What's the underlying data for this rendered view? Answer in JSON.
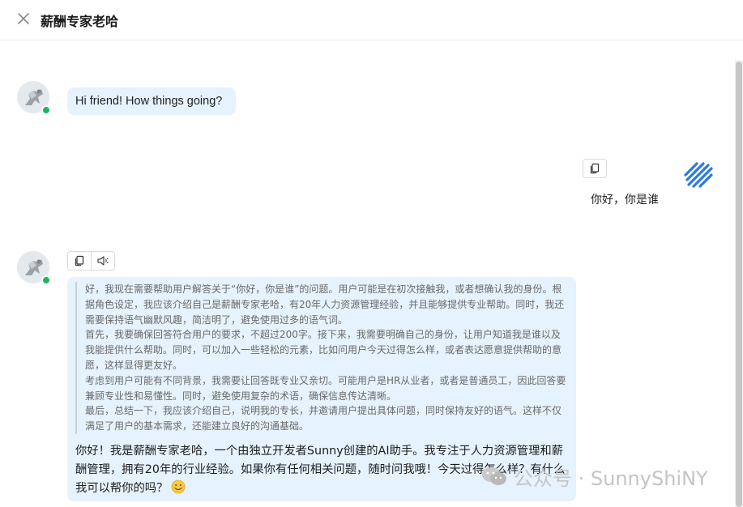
{
  "header": {
    "title": "薪酬专家老哈"
  },
  "messages": {
    "greeting": "Hi friend! How things going?",
    "user_question": "你好，你是谁",
    "thinking": [
      "好，我现在需要帮助用户解答关于“你好，你是谁”的问题。用户可能是在初次接触我，或者想确认我的身份。根据角色设定，我应该介绍自己是薪酬专家老哈，有20年人力资源管理经验，并且能够提供专业帮助。同时，我还需要保持语气幽默风趣，简洁明了，避免使用过多的语气词。",
      "首先，我要确保回答符合用户的要求，不超过200字。接下来，我需要明确自己的身份，让用户知道我是谁以及我能提供什么帮助。同时，可以加入一些轻松的元素，比如问用户今天过得怎么样，或者表达愿意提供帮助的意愿，这样显得更友好。",
      "考虑到用户可能有不同背景，我需要让回答既专业又亲切。可能用户是HR从业者，或者是普通员工，因此回答要兼顾专业性和易懂性。同时，避免使用复杂的术语，确保信息传达清晰。",
      "最后，总结一下，我应该介绍自己，说明我的专长，并邀请用户提出具体问题，同时保持友好的语气。这样不仅满足了用户的基本需求，还能建立良好的沟通基础。"
    ],
    "answer": "你好！我是薪酬专家老哈，一个由独立开发者Sunny创建的AI助手。我专注于人力资源管理和薪酬管理，拥有20年的行业经验。如果你有任何相关问题，随时问我哦！今天过得怎么样？有什么我可以帮你的吗？"
  },
  "watermark": {
    "text": "公众号 · SunnyShiNY"
  },
  "icons": {
    "close": "close-icon",
    "copy": "copy-icon",
    "speaker": "speaker-icon",
    "emoji": "smile-emoji-icon"
  },
  "colors": {
    "bubble_bg": "#e6f2fd",
    "online": "#22b35e",
    "brand_stripes": "#2b78e4"
  }
}
